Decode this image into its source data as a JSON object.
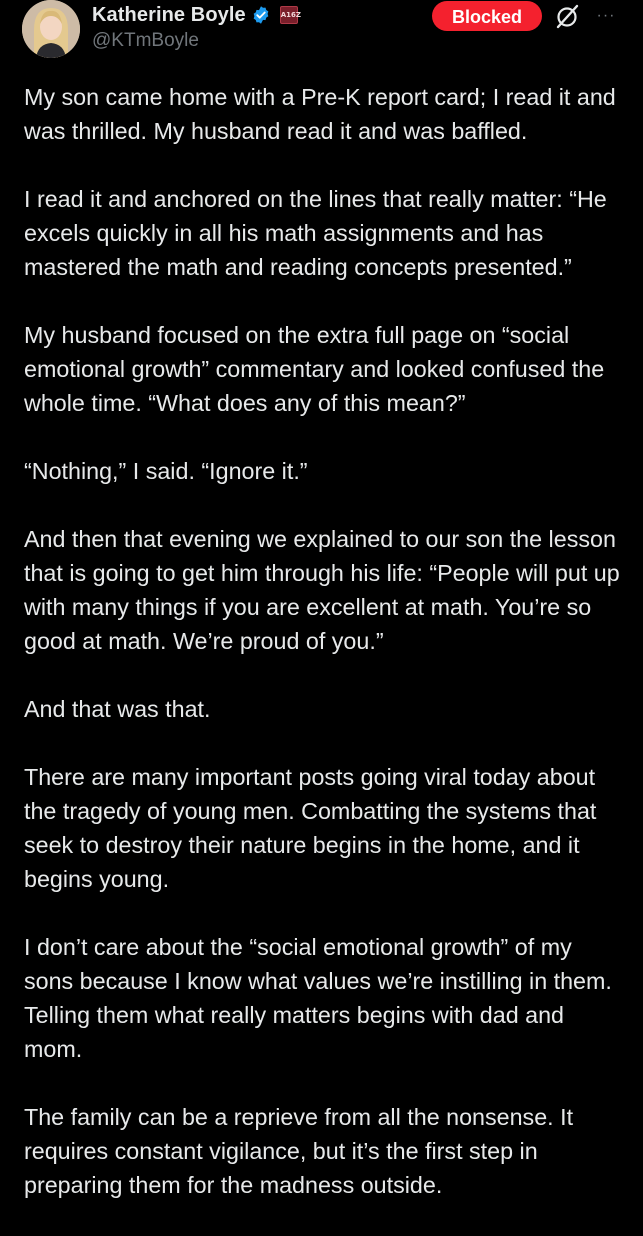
{
  "colors": {
    "background": "#000000",
    "text_primary": "#e7e9ea",
    "text_secondary": "#71767b",
    "blocked_red": "#f4212e",
    "verified_blue": "#1d9bf0"
  },
  "author": {
    "display_name": "Katherine Boyle",
    "handle": "@KTmBoyle",
    "verified_icon": "verified-badge-icon",
    "affiliate_badge_text": "A16Z",
    "avatar_icon": "profile-avatar"
  },
  "actions": {
    "blocked_label": "Blocked",
    "grok_icon": "grok-icon",
    "more_icon": "more-options-icon",
    "more_glyph": "···"
  },
  "tweet": {
    "paragraphs": [
      "My son came home with a Pre-K report card; I read it and was thrilled. My husband read it and was baffled.",
      "I read it and anchored on the lines that really matter: “He excels quickly in all his math assignments and has mastered the math and reading concepts presented.”",
      "My husband focused on the extra full page on “social emotional growth” commentary and looked confused the whole time. “What does any of this mean?”",
      "“Nothing,” I said. “Ignore it.”",
      "And then that evening we explained to our son the lesson that is going to get him through his life: “People will put up with many things if you are excellent at math. You’re so good at math. We’re proud of you.”",
      "And that was that.",
      "There are many important posts going viral today about the tragedy of young men. Combatting the systems that seek to destroy their nature begins in the home, and it begins young.",
      "I don’t care about the “social emotional growth” of my sons because I know what values we’re instilling in them. Telling them what really matters begins with dad and mom.",
      "The family can be a reprieve from all the nonsense. It requires constant vigilance, but it’s the first step in preparing them for the madness outside."
    ]
  }
}
